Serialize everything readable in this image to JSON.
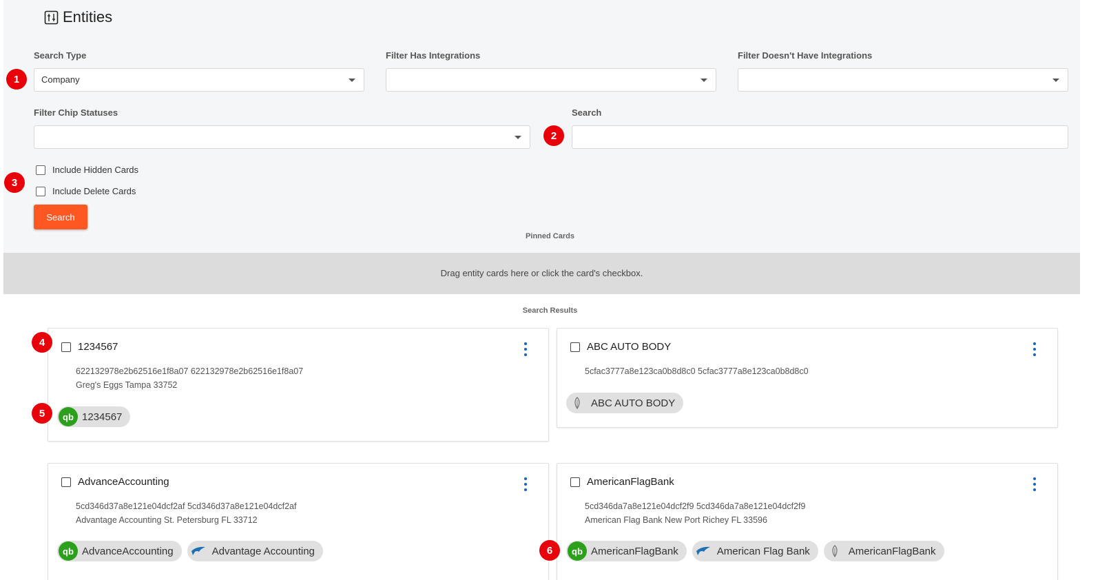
{
  "header": {
    "title": "Entities",
    "icon": "entities-icon"
  },
  "filters": {
    "search_type": {
      "label": "Search Type",
      "value": "Company"
    },
    "has_integrations": {
      "label": "Filter Has Integrations",
      "value": ""
    },
    "doesnt_have_integrations": {
      "label": "Filter Doesn't Have Integrations",
      "value": ""
    },
    "chip_statuses": {
      "label": "Filter Chip Statuses",
      "value": ""
    },
    "search": {
      "label": "Search",
      "value": ""
    },
    "include_hidden": "Include Hidden Cards",
    "include_deleted": "Include Delete Cards",
    "search_button": "Search"
  },
  "pinned": {
    "title": "Pinned Cards",
    "placeholder": "Drag entity cards here or click the card's checkbox."
  },
  "results": {
    "title": "Search Results",
    "cards": [
      {
        "name": "1234567",
        "ids": "622132978e2b62516e1f8a07 622132978e2b62516e1f8a07",
        "address": "Greg's Eggs Tampa 33752",
        "chips": [
          {
            "icon": "quickbooks-icon",
            "label": "1234567"
          }
        ]
      },
      {
        "name": "ABC AUTO BODY",
        "ids": "5cfac3777a8e123ca0b8d8c0 5cfac3777a8e123ca0b8d8c0",
        "address": "",
        "chips": [
          {
            "icon": "feather-icon",
            "label": "ABC AUTO BODY"
          }
        ]
      },
      {
        "name": "AdvanceAccounting",
        "ids": "5cd346d37a8e121e04dcf2af 5cd346d37a8e121e04dcf2af",
        "address": "Advantage Accounting St. Petersburg FL 33712",
        "chips": [
          {
            "icon": "quickbooks-icon",
            "label": "AdvanceAccounting"
          },
          {
            "icon": "bird-icon",
            "label": "Advantage Accounting"
          }
        ]
      },
      {
        "name": "AmericanFlagBank",
        "ids": "5cd346da7a8e121e04dcf2f9 5cd346da7a8e121e04dcf2f9",
        "address": "American Flag Bank New Port Richey FL 33596",
        "chips": [
          {
            "icon": "quickbooks-icon",
            "label": "AmericanFlagBank"
          },
          {
            "icon": "bird-icon",
            "label": "American Flag Bank"
          },
          {
            "icon": "feather-icon",
            "label": "AmericanFlagBank"
          }
        ]
      }
    ]
  },
  "markers": [
    "1",
    "2",
    "3",
    "4",
    "5",
    "6"
  ],
  "colors": {
    "accent": "#ff5722",
    "marker": "#e8000b",
    "quickbooks": "#2ca01c",
    "kebab": "#1565c0"
  }
}
